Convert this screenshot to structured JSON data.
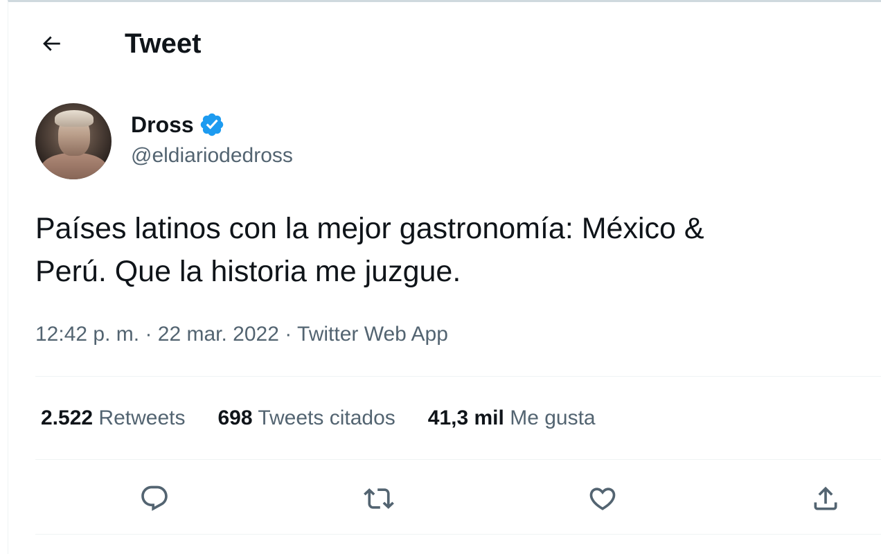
{
  "header": {
    "title": "Tweet",
    "back_icon": "arrow-left-icon"
  },
  "author": {
    "display_name": "Dross",
    "handle": "@eldiariodedross",
    "verified": true,
    "verified_color": "#1d9bf0"
  },
  "tweet": {
    "line1": "Países latinos con la mejor gastronomía: México &",
    "line2": "Perú. Que la historia me juzgue.",
    "time": "12:42 p. m.",
    "separator": "·",
    "date": "22 mar. 2022",
    "source": "Twitter Web App"
  },
  "stats": [
    {
      "value": "2.522",
      "label": "Retweets"
    },
    {
      "value": "698",
      "label": "Tweets citados"
    },
    {
      "value": "41,3 mil",
      "label": "Me gusta"
    }
  ],
  "actions": [
    {
      "icon": "reply-icon"
    },
    {
      "icon": "retweet-icon"
    },
    {
      "icon": "like-icon"
    },
    {
      "icon": "share-icon"
    }
  ],
  "colors": {
    "text_primary": "#0f1419",
    "text_secondary": "#536471",
    "divider": "#eff3f4"
  }
}
